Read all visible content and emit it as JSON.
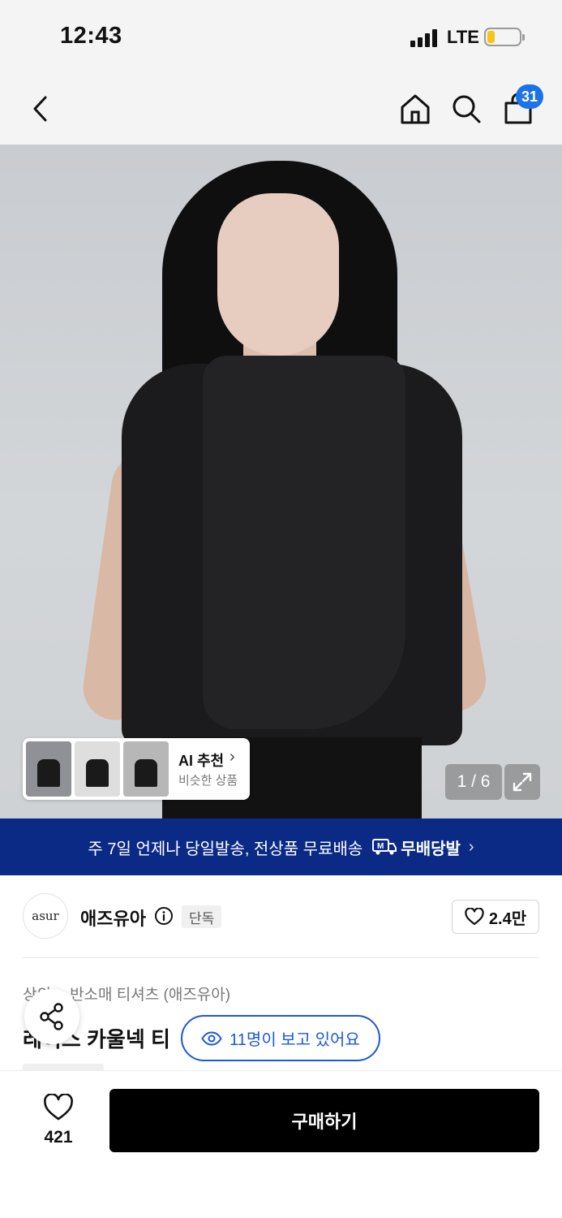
{
  "status_bar": {
    "time": "12:43",
    "network": "LTE",
    "battery_level": 0.2,
    "battery_color": "#f5c518"
  },
  "header": {
    "back_icon": "chevron-left-icon",
    "home_icon": "home-icon",
    "search_icon": "search-icon",
    "cart_icon": "shopping-bag-icon",
    "cart_count": "31",
    "badge_color": "#1a73e8"
  },
  "gallery": {
    "image_description_icon": "product-photo",
    "ai_recommend": {
      "title": "AI 추천",
      "subtitle": "비슷한 상품"
    },
    "page_counter": "1 / 6",
    "expand_icon": "expand-icon"
  },
  "promo": {
    "text": "주 7일 언제나 당일발송, 전상품 무료배송",
    "logo_text": "무배당발",
    "color": "#0a2a85"
  },
  "brand": {
    "logo_text": "asur",
    "name": "애즈유아",
    "badge": "단독",
    "likes": "2.4만"
  },
  "product": {
    "breadcrumb": [
      "상의",
      "반소매 티셔츠 (애즈유아)"
    ],
    "breadcrumb_sep": ">",
    "title": "레이스 카울넥 티"
  },
  "overlays": {
    "viewers_text": "11명이 보고 있어요",
    "accent_color": "#1a5ad7"
  },
  "bottom_bar": {
    "wish_count": "421",
    "buy_label": "구매하기"
  }
}
